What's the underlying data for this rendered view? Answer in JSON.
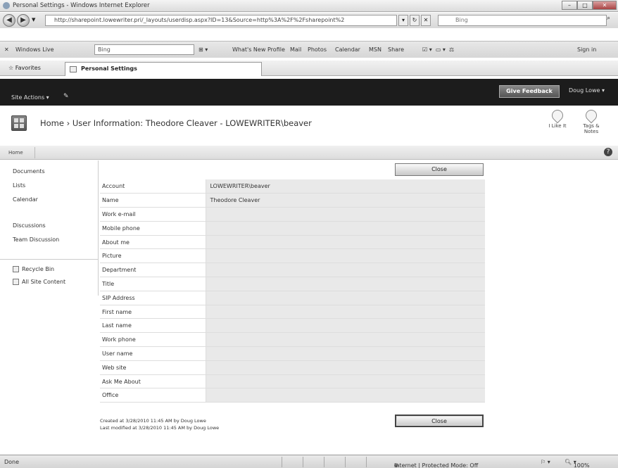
{
  "window": {
    "title": "Personal Settings - Windows Internet Explorer"
  },
  "address_bar": {
    "url": "http://sharepoint.lowewriter.pri/_layouts/userdisp.aspx?ID=13&Source=http%3A%2F%2Fsharepoint%2",
    "search_placeholder": "Bing"
  },
  "links_toolbar": {
    "windows_live": "Windows Live",
    "search_value": "Bing",
    "links": [
      "What's New",
      "Profile",
      "Mail",
      "Photos",
      "Calendar",
      "MSN",
      "Share"
    ],
    "sign_in": "Sign in"
  },
  "favorites_bar": {
    "favorites": "Favorites",
    "tab_title": "Personal Settings"
  },
  "sharepoint_bar": {
    "site_actions": "Site Actions",
    "give_feedback": "Give Feedback",
    "user": "Doug Lowe"
  },
  "page_header": {
    "title": "Home › User Information: Theodore Cleaver - LOWEWRITER\\beaver",
    "like_it": "I Like It",
    "tags_notes": "Tags & Notes"
  },
  "breadcrumb": {
    "home": "Home"
  },
  "left_nav": {
    "items": [
      "Documents",
      "Lists",
      "Calendar"
    ],
    "discussions_header": "Discussions",
    "discussion_items": [
      "Team Discussion"
    ],
    "recycle_bin": "Recycle Bin",
    "all_site_content": "All Site Content"
  },
  "close_button": "Close",
  "user_info": {
    "fields": [
      {
        "label": "Account",
        "value": "LOWEWRITER\\beaver"
      },
      {
        "label": "Name",
        "value": "Theodore Cleaver"
      },
      {
        "label": "Work e-mail",
        "value": ""
      },
      {
        "label": "Mobile phone",
        "value": ""
      },
      {
        "label": "About me",
        "value": ""
      },
      {
        "label": "Picture",
        "value": ""
      },
      {
        "label": "Department",
        "value": ""
      },
      {
        "label": "Title",
        "value": ""
      },
      {
        "label": "SIP Address",
        "value": ""
      },
      {
        "label": "First name",
        "value": ""
      },
      {
        "label": "Last name",
        "value": ""
      },
      {
        "label": "Work phone",
        "value": ""
      },
      {
        "label": "User name",
        "value": ""
      },
      {
        "label": "Web site",
        "value": ""
      },
      {
        "label": "Ask Me About",
        "value": ""
      },
      {
        "label": "Office",
        "value": ""
      }
    ],
    "created": "Created at 3/28/2010 11:45 AM by Doug Lowe",
    "modified": "Last modified at 3/28/2010 11:45 AM by Doug Lowe"
  },
  "status_bar": {
    "status": "Done",
    "zone": "Internet | Protected Mode: Off",
    "zoom": "100%"
  }
}
